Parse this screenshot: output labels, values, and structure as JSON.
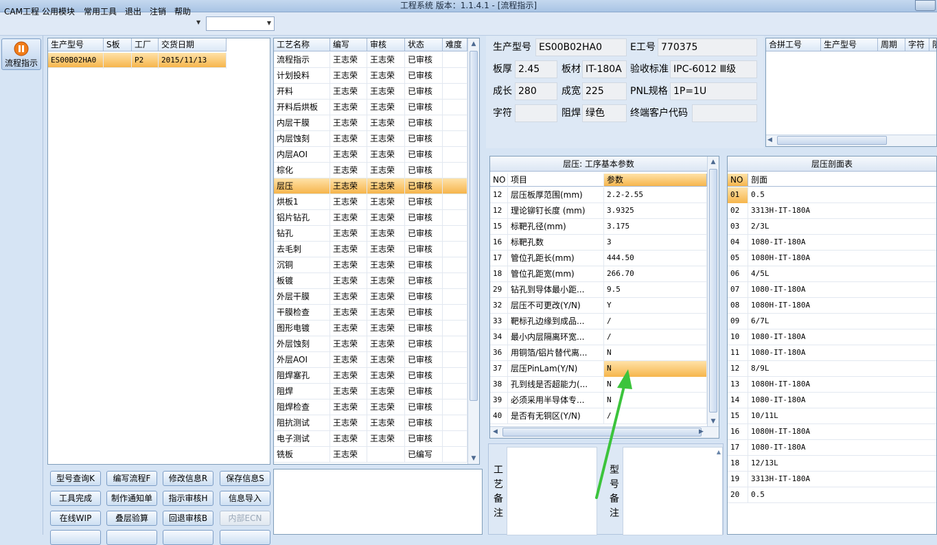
{
  "window": {
    "title": "工程系统  版本：1.1.4.1 - [流程指示]"
  },
  "menu": [
    "CAM工程",
    "公用模块",
    "常用工具",
    "退出",
    "注销",
    "帮助"
  ],
  "sidebar": {
    "button_label": "流程指示"
  },
  "product_list": {
    "headers": [
      "生产型号",
      "S板",
      "工厂",
      "交货日期"
    ],
    "rows": [
      [
        "ES00B02HA0",
        "",
        "P2",
        "2015/11/13"
      ]
    ]
  },
  "actions": [
    [
      "型号查询K",
      "编写流程F",
      "修改信息R",
      "保存信息S"
    ],
    [
      "工具完成",
      "制作通知单",
      "指示审核H",
      "信息导入"
    ],
    [
      "在线WIP",
      "叠层验算",
      "回退审核B",
      "内部ECN"
    ]
  ],
  "process_list": {
    "headers": [
      "工艺名称",
      "编写",
      "审核",
      "状态",
      "难度"
    ],
    "rows": [
      [
        "流程指示",
        "王志荣",
        "王志荣",
        "已审核"
      ],
      [
        "计划投料",
        "王志荣",
        "王志荣",
        "已审核"
      ],
      [
        "开料",
        "王志荣",
        "王志荣",
        "已审核"
      ],
      [
        "开料后烘板",
        "王志荣",
        "王志荣",
        "已审核"
      ],
      [
        "内层干膜",
        "王志荣",
        "王志荣",
        "已审核"
      ],
      [
        "内层蚀刻",
        "王志荣",
        "王志荣",
        "已审核"
      ],
      [
        "内层AOI",
        "王志荣",
        "王志荣",
        "已审核"
      ],
      [
        "棕化",
        "王志荣",
        "王志荣",
        "已审核"
      ],
      [
        "层压",
        "王志荣",
        "王志荣",
        "已审核"
      ],
      [
        "烘板1",
        "王志荣",
        "王志荣",
        "已审核"
      ],
      [
        "铝片钻孔",
        "王志荣",
        "王志荣",
        "已审核"
      ],
      [
        "钻孔",
        "王志荣",
        "王志荣",
        "已审核"
      ],
      [
        "去毛刺",
        "王志荣",
        "王志荣",
        "已审核"
      ],
      [
        "沉铜",
        "王志荣",
        "王志荣",
        "已审核"
      ],
      [
        "板镀",
        "王志荣",
        "王志荣",
        "已审核"
      ],
      [
        "外层干膜",
        "王志荣",
        "王志荣",
        "已审核"
      ],
      [
        "干膜检查",
        "王志荣",
        "王志荣",
        "已审核"
      ],
      [
        "图形电镀",
        "王志荣",
        "王志荣",
        "已审核"
      ],
      [
        "外层蚀刻",
        "王志荣",
        "王志荣",
        "已审核"
      ],
      [
        "外层AOI",
        "王志荣",
        "王志荣",
        "已审核"
      ],
      [
        "阻焊塞孔",
        "王志荣",
        "王志荣",
        "已审核"
      ],
      [
        "阻焊",
        "王志荣",
        "王志荣",
        "已审核"
      ],
      [
        "阻焊检查",
        "王志荣",
        "王志荣",
        "已审核"
      ],
      [
        "阻抗测试",
        "王志荣",
        "王志荣",
        "已审核"
      ],
      [
        "电子测试",
        "王志荣",
        "王志荣",
        "已审核"
      ],
      [
        "铣板",
        "王志荣",
        "",
        "已编写"
      ]
    ]
  },
  "info": {
    "model_label": "生产型号",
    "model_value": "ES00B02HA0",
    "eno_label": "E工号",
    "eno_value": "770375",
    "thickness_label": "板厚",
    "thickness_value": "2.45",
    "material_label": "板材",
    "material_value": "IT-180A",
    "standard_label": "验收标准",
    "standard_value": "IPC-6012 Ⅲ级",
    "length_label": "成长",
    "length_value": "280",
    "width_label": "成宽",
    "width_value": "225",
    "pnl_label": "PNL规格",
    "pnl_value": "1P=1U",
    "char_label": "字符",
    "char_value": "",
    "mask_label": "阻焊",
    "mask_value": "绿色",
    "customer_label": "终端客户代码",
    "customer_value": ""
  },
  "combined": {
    "headers": [
      "合拼工号",
      "生产型号",
      "周期",
      "字符",
      "阻"
    ]
  },
  "params": {
    "title": "层压: 工序基本参数",
    "headers": [
      "NO",
      "项目",
      "参数"
    ],
    "rows": [
      [
        "12",
        "层压板厚范围(mm)",
        "2.2-2.55"
      ],
      [
        "12",
        "理论铆钉长度 (mm)",
        "3.9325"
      ],
      [
        "15",
        "标靶孔径(mm)",
        "3.175"
      ],
      [
        "16",
        "标靶孔数",
        "3"
      ],
      [
        "17",
        "管位孔距长(mm)",
        "444.50"
      ],
      [
        "18",
        "管位孔距宽(mm)",
        "266.70"
      ],
      [
        "29",
        "钻孔到导体最小距...",
        "9.5"
      ],
      [
        "32",
        "层压不可更改(Y/N)",
        "Y"
      ],
      [
        "33",
        "靶标孔边缘到成品...",
        "/"
      ],
      [
        "34",
        "最小内层隔离环宽...",
        "/"
      ],
      [
        "36",
        "用铜箔/铝片替代离...",
        "N"
      ],
      [
        "37",
        "层压PinLam(Y/N)",
        "N"
      ],
      [
        "38",
        "孔到线是否超能力(...",
        "N"
      ],
      [
        "39",
        "必须采用半导体专...",
        "N"
      ],
      [
        "40",
        "是否有无铜区(Y/N)",
        "/"
      ]
    ]
  },
  "stackup": {
    "title": "层压剖面表",
    "headers": [
      "NO",
      "剖面"
    ],
    "rows": [
      [
        "01",
        "0.5"
      ],
      [
        "02",
        "3313H-IT-180A"
      ],
      [
        "03",
        "2/3L"
      ],
      [
        "04",
        "1080-IT-180A"
      ],
      [
        "05",
        "1080H-IT-180A"
      ],
      [
        "06",
        "4/5L"
      ],
      [
        "07",
        "1080-IT-180A"
      ],
      [
        "08",
        "1080H-IT-180A"
      ],
      [
        "09",
        "6/7L"
      ],
      [
        "10",
        "1080-IT-180A"
      ],
      [
        "11",
        "1080-IT-180A"
      ],
      [
        "12",
        "8/9L"
      ],
      [
        "13",
        "1080H-IT-180A"
      ],
      [
        "14",
        "1080-IT-180A"
      ],
      [
        "15",
        "10/11L"
      ],
      [
        "16",
        "1080H-IT-180A"
      ],
      [
        "17",
        "1080-IT-180A"
      ],
      [
        "18",
        "12/13L"
      ],
      [
        "19",
        "3313H-IT-180A"
      ],
      [
        "20",
        "0.5"
      ]
    ]
  },
  "remarks": {
    "process_label": [
      "工",
      "艺",
      "备",
      "注"
    ],
    "model_label": [
      "型",
      "号",
      "备",
      "注"
    ]
  },
  "colors": {
    "selected": "#f6b54c",
    "annotation_arrow": "#3cc43c"
  }
}
